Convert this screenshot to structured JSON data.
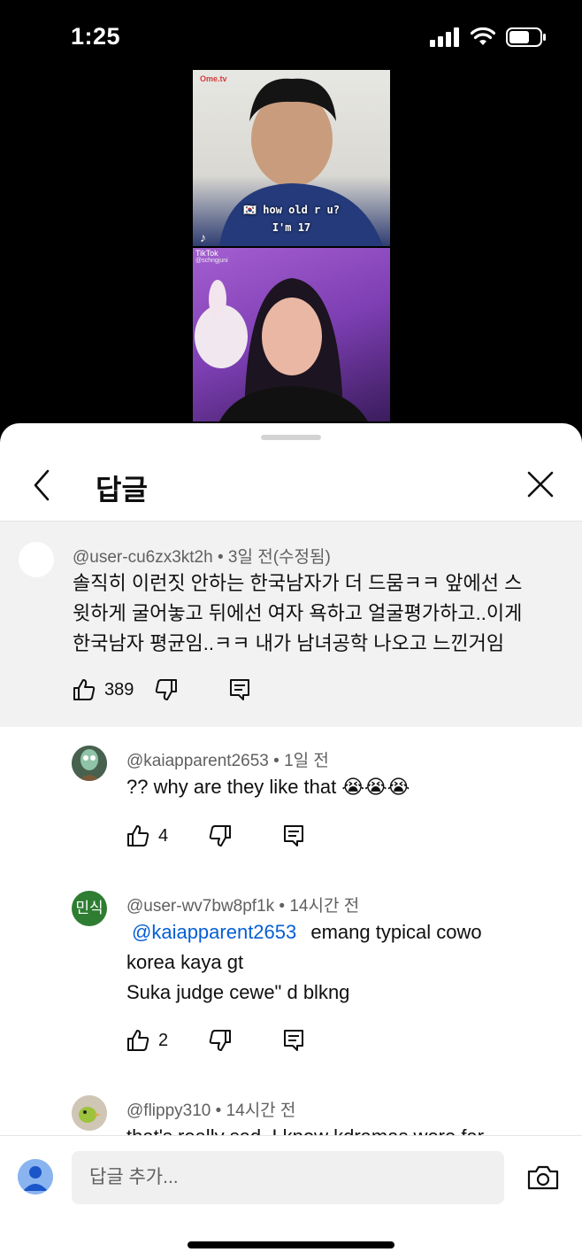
{
  "status": {
    "time": "1:25"
  },
  "video": {
    "watermark": "Ome.tv",
    "caption_line1": "🇰🇷 how old r u?",
    "caption_line2": "I'm 17",
    "tiktok_label": "TikTok",
    "tiktok_handle": "@schngjuni"
  },
  "header": {
    "title": "답글"
  },
  "parent": {
    "author": "@user-cu6zx3kt2h",
    "time": "3일 전(수정됨)",
    "lines": [
      "솔직히 이런짓 안하는 한국남자가 더 드뭄ㅋㅋ 앞에선 스",
      "윗하게 굴어놓고 뒤에선 여자 욕하고 얼굴평가하고..이게",
      "한국남자 평균임..ㅋㅋ 내가 남녀공학 나오고 느낀거임"
    ],
    "likes": "389"
  },
  "replies": [
    {
      "author": "@kaiapparent2653",
      "time": "1일 전",
      "text": "?? why are they like that 😭😭😭",
      "likes": "4"
    },
    {
      "author": "@user-wv7bw8pf1k",
      "time": "14시간 전",
      "avatar_text": "민식",
      "mention": "@kaiapparent2653",
      "text1": "emang typical cowo",
      "text2": "korea kaya gt",
      "text3": "Suka judge cewe\" d blkng",
      "likes": "2"
    },
    {
      "author": "@flippy310",
      "time": "14시간 전",
      "text": "that's really sad. I know kdramas were far"
    }
  ],
  "composer": {
    "placeholder": "답글 추가..."
  },
  "colors": {
    "accent": "#065fd4",
    "avatar_green": "#2e7d32",
    "avatar_blue": "#6fa3ef"
  },
  "icons": [
    "back-arrow-icon",
    "close-icon",
    "like-icon",
    "dislike-icon",
    "reply-icon",
    "camera-icon",
    "user-avatar-icon"
  ]
}
